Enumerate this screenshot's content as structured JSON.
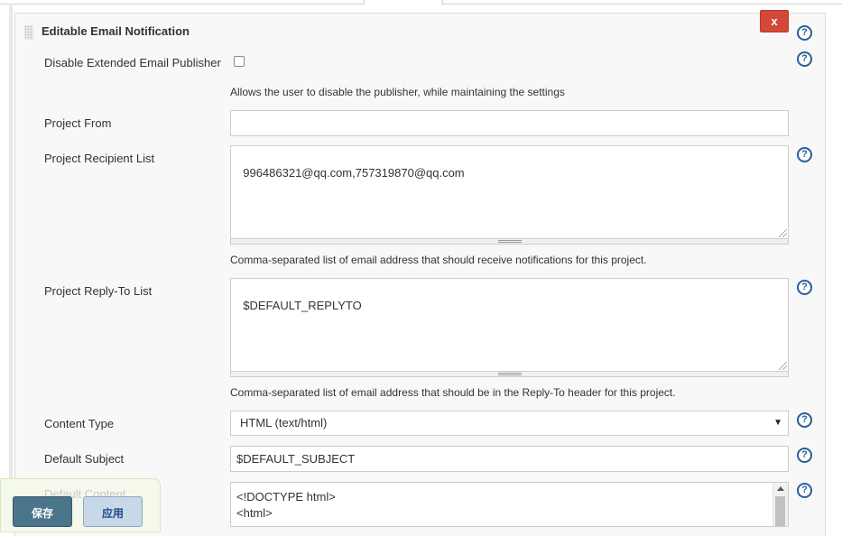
{
  "section": {
    "title": "Editable Email Notification",
    "delete_label": "x"
  },
  "help_glyph": "?",
  "icons": {
    "help": "help-icon",
    "delete": "close-icon",
    "grip": "drag-grip-icon",
    "dropdown": "triangle-down-icon"
  },
  "fields": {
    "disable_publisher": {
      "label": "Disable Extended Email Publisher",
      "checked": false,
      "description": "Allows the user to disable the publisher, while maintaining the settings"
    },
    "project_from": {
      "label": "Project From",
      "value": ""
    },
    "recipient_list": {
      "label": "Project Recipient List",
      "value": "996486321@qq.com,757319870@qq.com",
      "description": "Comma-separated list of email address that should receive notifications for this project."
    },
    "reply_to_list": {
      "label": "Project Reply-To List",
      "value": "$DEFAULT_REPLYTO",
      "description": "Comma-separated list of email address that should be in the Reply-To header for this project."
    },
    "content_type": {
      "label": "Content Type",
      "selected": "HTML (text/html)",
      "arrow": "▼"
    },
    "default_subject": {
      "label": "Default Subject",
      "value": "$DEFAULT_SUBJECT"
    },
    "default_content": {
      "label": "Default Content",
      "line1": "<!DOCTYPE html>",
      "line2": "<html>"
    }
  },
  "buttons": {
    "save": "保存",
    "apply": "应用"
  },
  "colors": {
    "delete": "#d24939",
    "help": "#2a5d98",
    "save": "#4b758b",
    "apply": "#c8d8e8"
  }
}
